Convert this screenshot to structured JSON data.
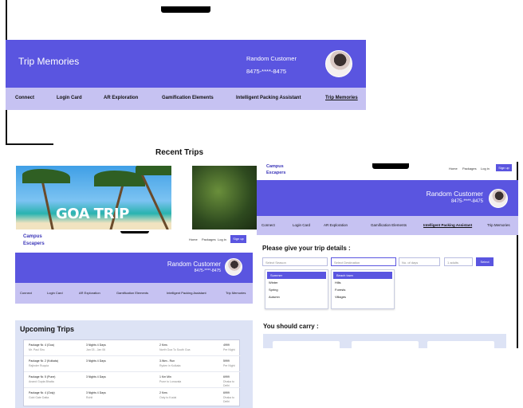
{
  "memories": {
    "title": "Trip Memories",
    "user_name": "Random Customer",
    "user_phone": "8475-****-8475",
    "nav": [
      "Connect",
      "Login Card",
      "AR Exploration",
      "Gamification Elements",
      "Intelligent Packing Assistant",
      "Trip Memories"
    ],
    "section_title": "Recent Trips",
    "card1_caption": "GOA TRIP"
  },
  "upcoming": {
    "brand_line1": "Campus",
    "brand_line2": "Escapers",
    "topnav": [
      "Home",
      "Packages",
      "Log in"
    ],
    "signup_label": "Sign up",
    "user_name": "Random Customer",
    "user_phone": "8475-****-8475",
    "nav": [
      "Connect",
      "Login Card",
      "AR Exploration",
      "Gamification Elements",
      "Intelligent Packing Assistant",
      "Trip Memories"
    ],
    "panel_title": "Upcoming Trips",
    "rows": [
      {
        "c1": "Package Nr. 4 (Goa)",
        "c1s": "Mr. Paul Siru",
        "c2": "3 Nights 4 Days",
        "c2s": "Jan 03 - Jan 06",
        "c3": "2 Kms",
        "c3s": "North Goa To South Goa",
        "c4": "4999",
        "c4s": "Per Night"
      },
      {
        "c1": "Package Nr. 2 (Kolkata)",
        "c1s": "Rajinder Ruquia",
        "c2": "3 Nights 4 Days",
        "c2s": "",
        "c3": "3.9km - Run",
        "c3s": "Ryden in Kolkata",
        "c4": "5999",
        "c4s": "Per Night"
      },
      {
        "c1": "Package Nr. 5 (Pune)",
        "c1s": "Anand Gupta Bhatta",
        "c2": "3 Nights 4 Days",
        "c2s": "",
        "c3": "1 Km Min",
        "c3s": "Pune to Lonavala",
        "c4": "6999",
        "c4s": "Dhaka to Delhi"
      },
      {
        "c1": "Package Nr. 4 (Ooty)",
        "c1s": "Gobi Gate Datta",
        "c2": "3 Nights 4 Days",
        "c2s": "Rohit",
        "c3": "2 Kms",
        "c3s": "Ooty to Kodai",
        "c4": "6999",
        "c4s": "Dhaka to Delhi"
      }
    ]
  },
  "packing": {
    "brand_line1": "Campus",
    "brand_line2": "Escapers",
    "topnav": [
      "Home",
      "Packages",
      "Log in"
    ],
    "signup_label": "Sign up",
    "user_name": "Random Customer",
    "user_phone": "8475-****-8475",
    "nav": [
      "Connect",
      "Login Card",
      "AR Exploration",
      "Gamification Elements",
      "Intelligent Packing Assistant",
      "Trip Memories"
    ],
    "prompt": "Please give your trip details :",
    "field_season": "Select Season",
    "field_destination": "Select Destination",
    "field_duration": "No. of days",
    "field_people": "1 adults",
    "select_label": "Select",
    "season_options": [
      "Summer",
      "Winter",
      "Spring",
      "Autumn"
    ],
    "destination_options": [
      "Beach town",
      "Hills",
      "Forests",
      "Villages"
    ],
    "carry_title": "You should carry :"
  },
  "colors": {
    "header": "#5a55e0",
    "nav": "#c6c2f2",
    "panel": "#dde3f5"
  }
}
